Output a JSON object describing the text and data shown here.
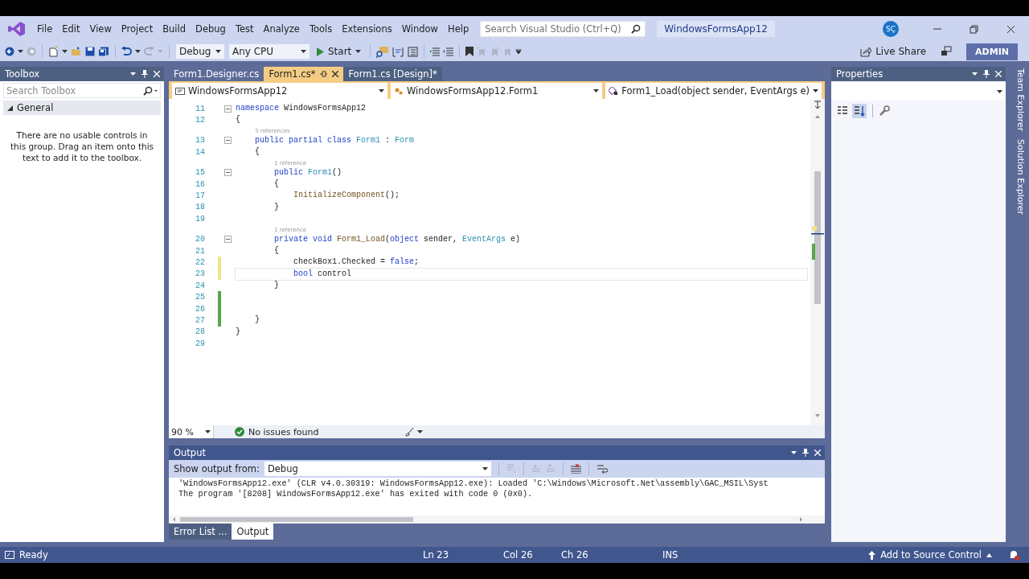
{
  "title_bar": {
    "menu": [
      "File",
      "Edit",
      "View",
      "Project",
      "Build",
      "Debug",
      "Test",
      "Analyze",
      "Tools",
      "Extensions",
      "Window",
      "Help"
    ],
    "search": {
      "placeholder": "Search Visual Studio (Ctrl+Q)"
    },
    "solution_name": "WindowsFormsApp12",
    "avatar": "SÇ"
  },
  "toolbar": {
    "configuration": "Debug",
    "platform": "Any CPU",
    "start": "Start",
    "live_share": "Live Share",
    "account": "ADMIN"
  },
  "toolbox": {
    "title": "Toolbox",
    "search": {
      "placeholder": "Search Toolbox"
    },
    "group": {
      "label": "General",
      "expanded": true
    },
    "message": "There are no usable controls in this group. Drag an item onto this text to add it to the toolbox."
  },
  "editor": {
    "tabs": [
      {
        "label": "Form1.Designer.cs",
        "selected": false
      },
      {
        "label": "Form1.cs*",
        "selected": true
      },
      {
        "label": "Form1.cs [Design]*",
        "selected": false
      }
    ],
    "nav": [
      "WindowsFormsApp12",
      "WindowsFormsApp12.Form1",
      "Form1_Load(object sender, EventArgs e)"
    ],
    "lines": [
      {
        "number": "11",
        "fold": true,
        "changed": false,
        "tokens": [
          {
            "kind": "keyword",
            "text": "namespace"
          },
          {
            "kind": "plain",
            "text": " WindowsFormsApp12"
          }
        ]
      },
      {
        "number": "12",
        "fold": false,
        "changed": false,
        "tokens": [
          {
            "kind": "plain",
            "text": "{"
          }
        ]
      },
      {
        "number": "13",
        "fold": true,
        "changed": false,
        "lens": "3 references",
        "tokens": [
          {
            "kind": "keyword",
            "text": "    public partial class"
          },
          {
            "kind": "type",
            "text": " Form1"
          },
          {
            "kind": "plain",
            "text": " : "
          },
          {
            "kind": "type",
            "text": "Form"
          }
        ]
      },
      {
        "number": "14",
        "fold": false,
        "changed": false,
        "tokens": [
          {
            "kind": "plain",
            "text": "    {"
          }
        ]
      },
      {
        "number": "15",
        "fold": true,
        "changed": false,
        "lens": "1 reference",
        "tokens": [
          {
            "kind": "keyword",
            "text": "        public"
          },
          {
            "kind": "type",
            "text": " Form1"
          },
          {
            "kind": "plain",
            "text": "()"
          }
        ]
      },
      {
        "number": "16",
        "fold": false,
        "changed": false,
        "tokens": [
          {
            "kind": "plain",
            "text": "        {"
          }
        ]
      },
      {
        "number": "17",
        "fold": false,
        "changed": false,
        "tokens": [
          {
            "kind": "method",
            "text": "            InitializeComponent"
          },
          {
            "kind": "plain",
            "text": "();"
          }
        ]
      },
      {
        "number": "18",
        "fold": false,
        "changed": false,
        "tokens": [
          {
            "kind": "plain",
            "text": "        }"
          }
        ]
      },
      {
        "number": "19",
        "fold": false,
        "changed": false
      },
      {
        "number": "20",
        "fold": true,
        "changed": false,
        "lens": "1 reference",
        "tokens": [
          {
            "kind": "keyword",
            "text": "        private void"
          },
          {
            "kind": "method",
            "text": " Form1_Load"
          },
          {
            "kind": "plain",
            "text": "("
          },
          {
            "kind": "keyword",
            "text": "object"
          },
          {
            "kind": "plain",
            "text": " sender, "
          },
          {
            "kind": "type",
            "text": "EventArgs"
          },
          {
            "kind": "plain",
            "text": " e)"
          }
        ]
      },
      {
        "number": "21",
        "fold": false,
        "changed": false,
        "tokens": [
          {
            "kind": "plain",
            "text": "        {"
          }
        ]
      },
      {
        "number": "22",
        "fold": false,
        "changed": true,
        "saved": false,
        "tokens": [
          {
            "kind": "plain",
            "text": "            checkBox1.Checked = "
          },
          {
            "kind": "keyword",
            "text": "false"
          },
          {
            "kind": "plain",
            "text": ";"
          }
        ]
      },
      {
        "number": "23",
        "fold": false,
        "changed": true,
        "saved": false,
        "current": true,
        "tokens": [
          {
            "kind": "keyword",
            "text": "            bool"
          },
          {
            "kind": "plain",
            "text": " control"
          }
        ]
      },
      {
        "number": "24",
        "fold": false,
        "changed": false,
        "tokens": [
          {
            "kind": "plain",
            "text": "        }"
          }
        ]
      },
      {
        "number": "25",
        "fold": false,
        "changed": true,
        "saved": true
      },
      {
        "number": "26",
        "fold": false,
        "changed": true,
        "saved": true
      },
      {
        "number": "27",
        "fold": false,
        "changed": true,
        "saved": true,
        "tokens": [
          {
            "kind": "plain",
            "text": "    }"
          }
        ]
      },
      {
        "number": "28",
        "fold": false,
        "changed": false,
        "tokens": [
          {
            "kind": "plain",
            "text": "}"
          }
        ]
      },
      {
        "number": "29",
        "fold": false,
        "changed": false
      }
    ],
    "zoom": "90 %",
    "issues": "No issues found"
  },
  "output": {
    "title": "Output",
    "source_label": "Show output from:",
    "source": "Debug",
    "lines": [
      "'WindowsFormsApp12.exe' (CLR v4.0.30319: WindowsFormsApp12.exe): Loaded 'C:\\Windows\\Microsoft.Net\\assembly\\GAC_MSIL\\Syst",
      "The program '[8208] WindowsFormsApp12.exe' has exited with code 0 (0x0)."
    ],
    "tabs": [
      {
        "label": "Error List ...",
        "selected": false
      },
      {
        "label": "Output",
        "selected": true
      }
    ]
  },
  "properties": {
    "title": "Properties"
  },
  "side_tabs": [
    "Team Explorer",
    "Solution Explorer"
  ],
  "status_bar": {
    "state": "Ready",
    "line": "Ln 23",
    "column": "Col 26",
    "char": "Ch 26",
    "mode": "INS",
    "source_control": "Add to Source Control"
  }
}
